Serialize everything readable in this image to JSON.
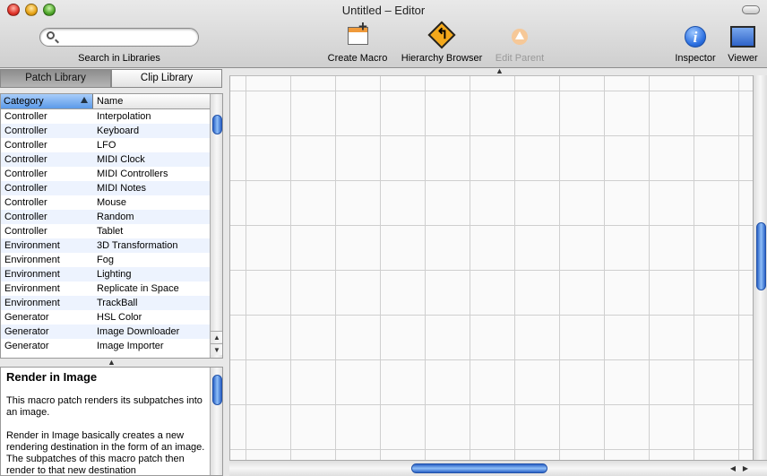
{
  "window": {
    "title": "Untitled – Editor"
  },
  "toolbar": {
    "search": {
      "placeholder": "",
      "value": "",
      "label": "Search in Libraries"
    },
    "buttons": [
      {
        "label": "Create Macro",
        "icon": "create-macro-icon",
        "enabled": true
      },
      {
        "label": "Hierarchy Browser",
        "icon": "hierarchy-browser-icon",
        "enabled": true
      },
      {
        "label": "Edit Parent",
        "icon": "edit-parent-icon",
        "enabled": false
      },
      {
        "label": "Inspector",
        "icon": "info-icon",
        "enabled": true
      },
      {
        "label": "Viewer",
        "icon": "viewer-icon",
        "enabled": true
      }
    ]
  },
  "library": {
    "tabs": [
      {
        "label": "Patch Library",
        "selected": true
      },
      {
        "label": "Clip Library",
        "selected": false
      }
    ],
    "columns": [
      "Category",
      "Name"
    ],
    "rows": [
      {
        "category": "Controller",
        "name": "Interpolation"
      },
      {
        "category": "Controller",
        "name": "Keyboard"
      },
      {
        "category": "Controller",
        "name": "LFO"
      },
      {
        "category": "Controller",
        "name": "MIDI Clock"
      },
      {
        "category": "Controller",
        "name": "MIDI Controllers"
      },
      {
        "category": "Controller",
        "name": "MIDI Notes"
      },
      {
        "category": "Controller",
        "name": "Mouse"
      },
      {
        "category": "Controller",
        "name": "Random"
      },
      {
        "category": "Controller",
        "name": "Tablet"
      },
      {
        "category": "Environment",
        "name": "3D Transformation"
      },
      {
        "category": "Environment",
        "name": "Fog"
      },
      {
        "category": "Environment",
        "name": "Lighting"
      },
      {
        "category": "Environment",
        "name": "Replicate in Space"
      },
      {
        "category": "Environment",
        "name": "TrackBall"
      },
      {
        "category": "Generator",
        "name": "HSL Color"
      },
      {
        "category": "Generator",
        "name": "Image Downloader"
      },
      {
        "category": "Generator",
        "name": "Image Importer"
      }
    ]
  },
  "description": {
    "title": "Render in Image",
    "body": "This macro patch renders its subpatches into an image.\n\nRender in Image basically creates a new rendering destination in the form of an image. The subpatches of this macro patch then render to that new destination"
  },
  "colors": {
    "selection": "#5b9ae8",
    "scroll_thumb": "#2b62c7",
    "alt_row": "#edf3fe",
    "grid": "#cfcfcf"
  }
}
